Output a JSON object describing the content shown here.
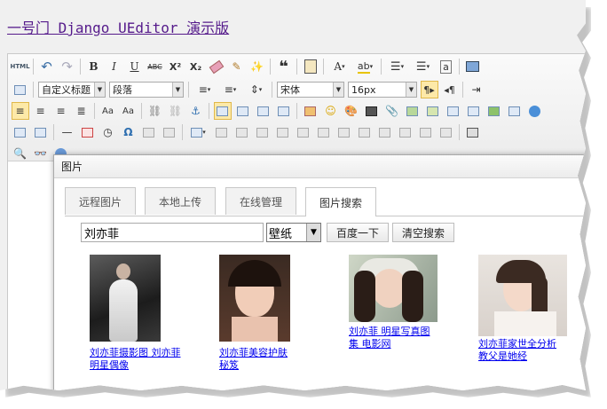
{
  "page": {
    "title": "一号门 Django UEditor 演示版"
  },
  "toolbar": {
    "row1": [
      "source-icon",
      "undo-icon",
      "redo-icon",
      "bold-icon",
      "italic-icon",
      "underline-icon",
      "strikethrough-icon",
      "superscript-icon",
      "subscript-icon",
      "eraser-icon",
      "format-brush-icon",
      "auto-format-icon",
      "blockquote-icon",
      "paste-plain-icon",
      "font-color-icon",
      "highlight-color-icon",
      "ordered-list-icon",
      "unordered-list-icon",
      "select-all-icon",
      "preview-icon"
    ],
    "custom_style": "自定义标题",
    "paragraph": "段落",
    "font_family": "宋体",
    "font_size": "16px",
    "html_label": "HTML",
    "quote_label": "❝",
    "bold_label": "B",
    "italic_label": "I",
    "underline_label": "U",
    "strike_label": "ABC",
    "sup_label": "X²",
    "sub_label": "X₂",
    "fontcolor_label": "A",
    "highlight_label": "ab",
    "select_label": "a",
    "omega_label": "Ω"
  },
  "dialog": {
    "title": "图片",
    "tabs": [
      "远程图片",
      "本地上传",
      "在线管理",
      "图片搜索"
    ],
    "active_tab": "图片搜索",
    "search_value": "刘亦菲",
    "category": "壁纸",
    "search_button": "百度一下",
    "clear_button": "清空搜索",
    "results": [
      {
        "caption": "刘亦菲摄影图 刘亦菲 明星偶像"
      },
      {
        "caption": "刘亦菲美容护肤秘笈"
      },
      {
        "caption": "刘亦菲 明星写真图集 电影网"
      },
      {
        "caption": "刘亦菲家世全分析 教父是她经"
      }
    ]
  }
}
